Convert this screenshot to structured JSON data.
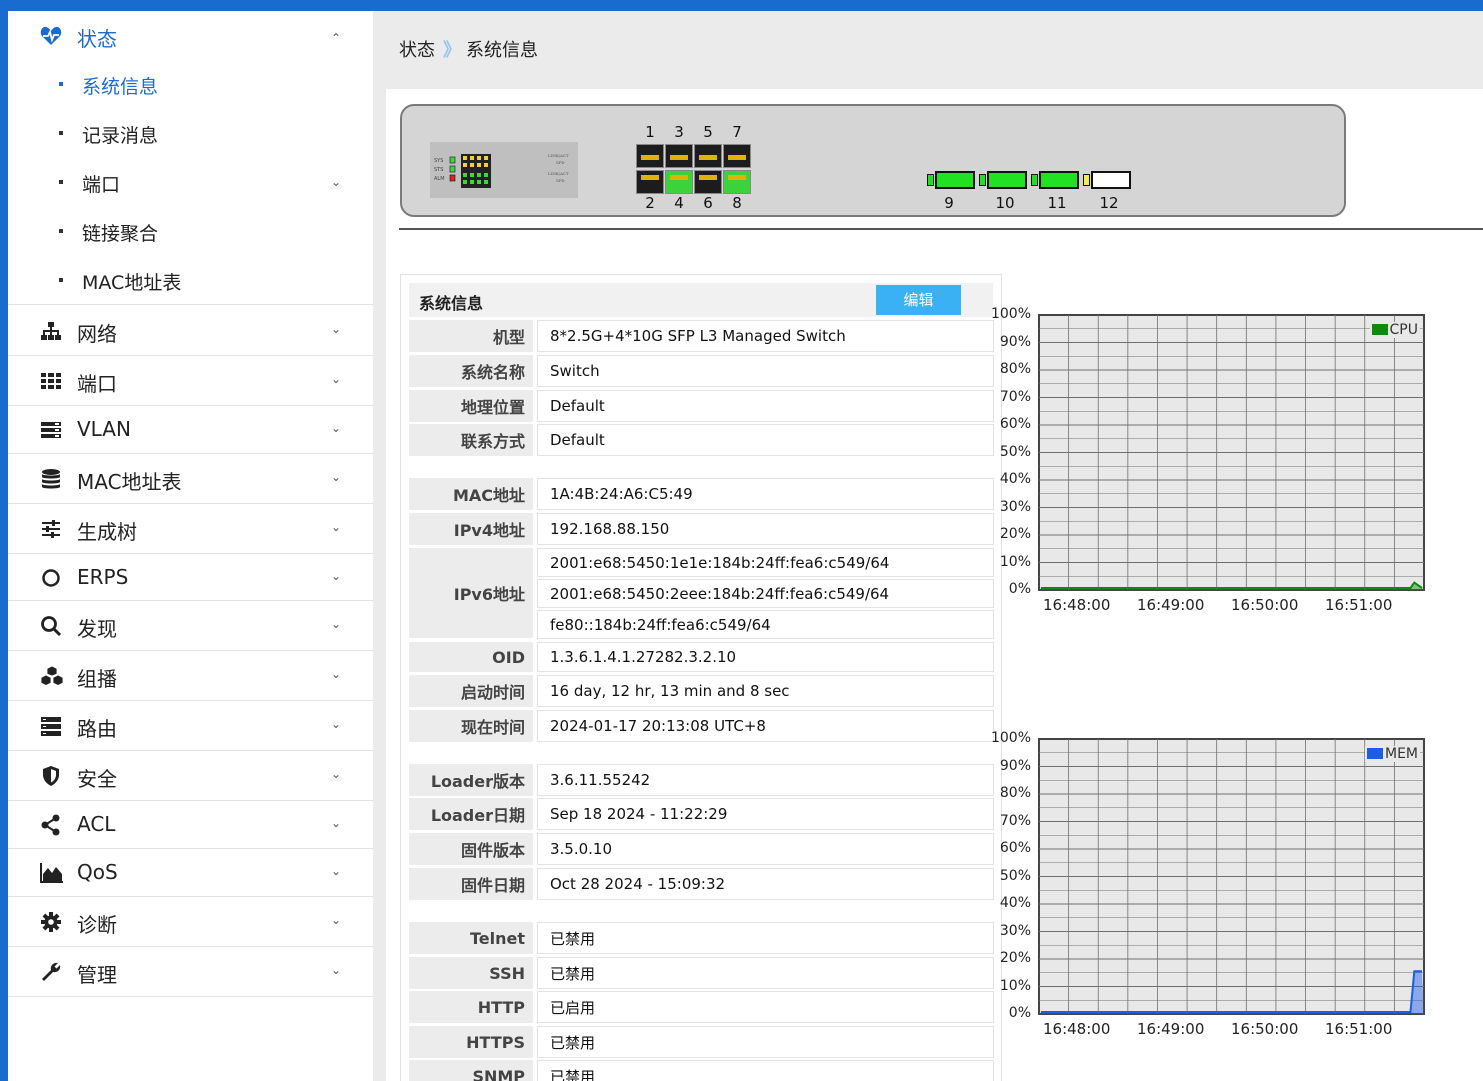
{
  "sidebar": {
    "status": {
      "label": "状态",
      "items": [
        {
          "label": "系统信息",
          "active": true
        },
        {
          "label": "记录消息"
        },
        {
          "label": "端口",
          "has_sub": true
        },
        {
          "label": "链接聚合"
        },
        {
          "label": "MAC地址表"
        }
      ]
    },
    "menu": [
      {
        "label": "网络",
        "icon": "sitemap-icon"
      },
      {
        "label": "端口",
        "icon": "grid-icon"
      },
      {
        "label": "VLAN",
        "icon": "server-icon"
      },
      {
        "label": "MAC地址表",
        "icon": "database-icon"
      },
      {
        "label": "生成树",
        "icon": "sliders-icon"
      },
      {
        "label": "ERPS",
        "icon": "ring-icon"
      },
      {
        "label": "发现",
        "icon": "search-icon"
      },
      {
        "label": "组播",
        "icon": "cubes-icon"
      },
      {
        "label": "路由",
        "icon": "list-icon"
      },
      {
        "label": "安全",
        "icon": "shield-icon"
      },
      {
        "label": "ACL",
        "icon": "share-icon"
      },
      {
        "label": "QoS",
        "icon": "area-chart-icon"
      },
      {
        "label": "诊断",
        "icon": "gear-icon"
      },
      {
        "label": "管理",
        "icon": "wrench-icon"
      }
    ]
  },
  "breadcrumb": {
    "parent": "状态",
    "separator": "》",
    "current": "系统信息"
  },
  "device": {
    "rj45_top": [
      "1",
      "3",
      "5",
      "7"
    ],
    "rj45_bottom": [
      "2",
      "4",
      "6",
      "8"
    ],
    "sfp": [
      "9",
      "10",
      "11",
      "12"
    ]
  },
  "info": {
    "title": "系统信息",
    "edit_label": "编辑",
    "rows": [
      {
        "key": "机型",
        "value": "8*2.5G+4*10G SFP L3 Managed Switch"
      },
      {
        "key": "系统名称",
        "value": "Switch"
      },
      {
        "key": "地理位置",
        "value": "Default"
      },
      {
        "key": "联系方式",
        "value": "Default"
      },
      {
        "key": "MAC地址",
        "value": "1A:4B:24:A6:C5:49"
      },
      {
        "key": "IPv4地址",
        "value": "192.168.88.150"
      },
      {
        "key": "IPv6地址",
        "values": [
          "2001:e68:5450:1e1e:184b:24ff:fea6:c549/64",
          "2001:e68:5450:2eee:184b:24ff:fea6:c549/64",
          "fe80::184b:24ff:fea6:c549/64"
        ]
      },
      {
        "key": "OID",
        "value": "1.3.6.1.4.1.27282.3.2.10"
      },
      {
        "key": "启动时间",
        "value": "16 day, 12 hr, 13 min and 8 sec"
      },
      {
        "key": "现在时间",
        "value": "2024-01-17 20:13:08 UTC+8"
      },
      {
        "key": "Loader版本",
        "value": "3.6.11.55242"
      },
      {
        "key": "Loader日期",
        "value": "Sep 18 2024 - 11:22:29"
      },
      {
        "key": "固件版本",
        "value": "3.5.0.10"
      },
      {
        "key": "固件日期",
        "value": "Oct 28 2024 - 15:09:32"
      },
      {
        "key": "Telnet",
        "value": "已禁用"
      },
      {
        "key": "SSH",
        "value": "已禁用"
      },
      {
        "key": "HTTP",
        "value": "已启用"
      },
      {
        "key": "HTTPS",
        "value": "已禁用"
      },
      {
        "key": "SNMP",
        "value": "已禁用"
      }
    ]
  },
  "chart_data": [
    {
      "type": "area",
      "series": [
        {
          "name": "CPU",
          "color": "#0e8a0e",
          "values": [
            0,
            0,
            0,
            0,
            0,
            0,
            0,
            0,
            0,
            0,
            0,
            0,
            0,
            0,
            0,
            0,
            0,
            0,
            0,
            0,
            0,
            0,
            0,
            0,
            0,
            0,
            0,
            0,
            0,
            0,
            0,
            0,
            0,
            0,
            0,
            0,
            0,
            0,
            0,
            0,
            0,
            0,
            0,
            0,
            0,
            0,
            0,
            0,
            0,
            0,
            0,
            0,
            0,
            0,
            0,
            0,
            0,
            0,
            0,
            0,
            0,
            0,
            0,
            0,
            0,
            0,
            0,
            0,
            0,
            0,
            0,
            0,
            0,
            0,
            0,
            0,
            0,
            0,
            0,
            0,
            0,
            0,
            0,
            0,
            0,
            0,
            0,
            0,
            0,
            0,
            0,
            0,
            0,
            0,
            0,
            0,
            0,
            2,
            1,
            0
          ]
        }
      ],
      "yticks": [
        "100%",
        "90%",
        "80%",
        "70%",
        "60%",
        "50%",
        "40%",
        "30%",
        "20%",
        "10%",
        "0%"
      ],
      "xticks": [
        "16:48:00",
        "16:49:00",
        "16:50:00",
        "16:51:00"
      ],
      "ylim": [
        0,
        100
      ],
      "grid": true,
      "legend": "top-right"
    },
    {
      "type": "area",
      "series": [
        {
          "name": "MEM",
          "color": "#1a5ee8",
          "values": [
            0,
            0,
            0,
            0,
            0,
            0,
            0,
            0,
            0,
            0,
            0,
            0,
            0,
            0,
            0,
            0,
            0,
            0,
            0,
            0,
            0,
            0,
            0,
            0,
            0,
            0,
            0,
            0,
            0,
            0,
            0,
            0,
            0,
            0,
            0,
            0,
            0,
            0,
            0,
            0,
            0,
            0,
            0,
            0,
            0,
            0,
            0,
            0,
            0,
            0,
            0,
            0,
            0,
            0,
            0,
            0,
            0,
            0,
            0,
            0,
            0,
            0,
            0,
            0,
            0,
            0,
            0,
            0,
            0,
            0,
            0,
            0,
            0,
            0,
            0,
            0,
            0,
            0,
            0,
            0,
            0,
            0,
            0,
            0,
            0,
            0,
            0,
            0,
            0,
            0,
            0,
            0,
            0,
            0,
            0,
            0,
            0,
            15,
            15,
            15
          ]
        }
      ],
      "yticks": [
        "100%",
        "90%",
        "80%",
        "70%",
        "60%",
        "50%",
        "40%",
        "30%",
        "20%",
        "10%",
        "0%"
      ],
      "xticks": [
        "16:48:00",
        "16:49:00",
        "16:50:00",
        "16:51:00"
      ],
      "ylim": [
        0,
        100
      ],
      "grid": true,
      "legend": "top-right"
    }
  ]
}
